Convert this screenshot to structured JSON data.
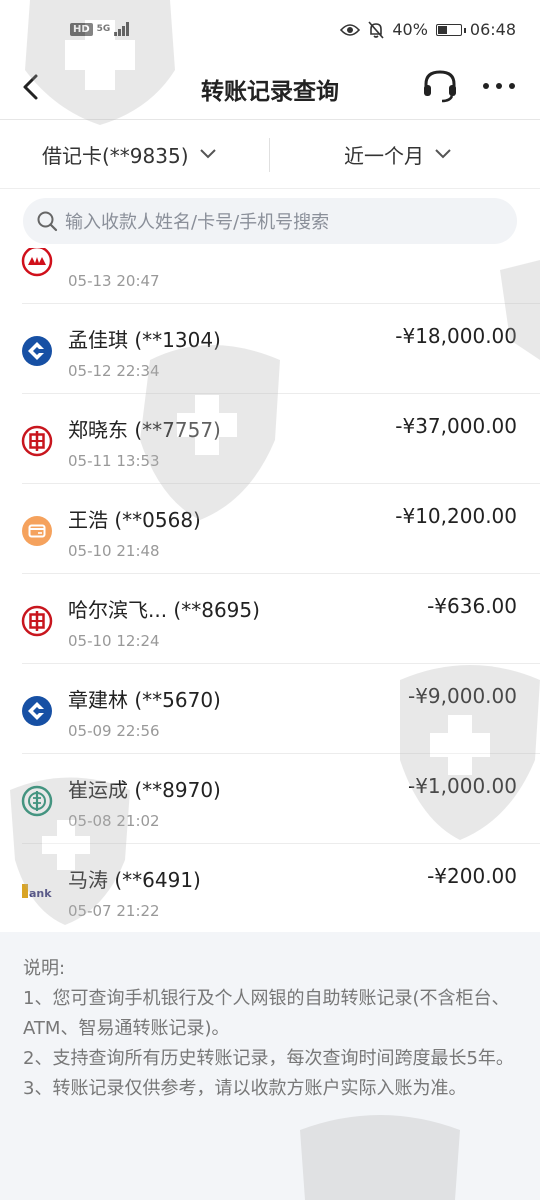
{
  "status_bar": {
    "hd": "HD",
    "network": "5G",
    "battery": "40%",
    "time": "06:48"
  },
  "header": {
    "title": "转账记录查询"
  },
  "filters": {
    "card": "借记卡(**9835)",
    "range": "近一个月"
  },
  "search": {
    "placeholder": "输入收款人姓名/卡号/手机号搜索"
  },
  "records": [
    {
      "name": "",
      "time": "05-13 20:47",
      "amount": "",
      "bank_icon": "cmb-bank-icon"
    },
    {
      "name": "孟佳琪 (**1304)",
      "time": "05-12 22:34",
      "amount": "-¥18,000.00",
      "bank_icon": "ccb-bank-icon"
    },
    {
      "name": "郑晓东 (**7757)",
      "time": "05-11 13:53",
      "amount": "-¥37,000.00",
      "bank_icon": "icbc-bank-icon"
    },
    {
      "name": "王浩 (**0568)",
      "time": "05-10 21:48",
      "amount": "-¥10,200.00",
      "bank_icon": "card-icon"
    },
    {
      "name": "哈尔滨飞... (**8695)",
      "time": "05-10 12:24",
      "amount": "-¥636.00",
      "bank_icon": "icbc-bank-icon"
    },
    {
      "name": "章建林 (**5670)",
      "time": "05-09 22:56",
      "amount": "-¥9,000.00",
      "bank_icon": "ccb-bank-icon"
    },
    {
      "name": "崔运成 (**8970)",
      "time": "05-08 21:02",
      "amount": "-¥1,000.00",
      "bank_icon": "abc-bank-icon"
    },
    {
      "name": "马涛 (**6491)",
      "time": "05-07 21:22",
      "amount": "-¥200.00",
      "bank_icon": "bank-logo-icon"
    }
  ],
  "notes": {
    "title": "说明:",
    "items": [
      "1、您可查询手机银行及个人网银的自助转账记录(不含柜台、ATM、智易通转账记录)。",
      "2、支持查询所有历史转账记录，每次查询时间跨度最长5年。",
      "3、转账记录仅供参考，请以收款方账户实际入账为准。"
    ]
  },
  "colors": {
    "ccb_blue": "#1750a4",
    "icbc_red": "#c8161e",
    "abc_green": "#1a8a6e",
    "cmb_red": "#d0101b",
    "card_orange": "#f5a25d"
  }
}
